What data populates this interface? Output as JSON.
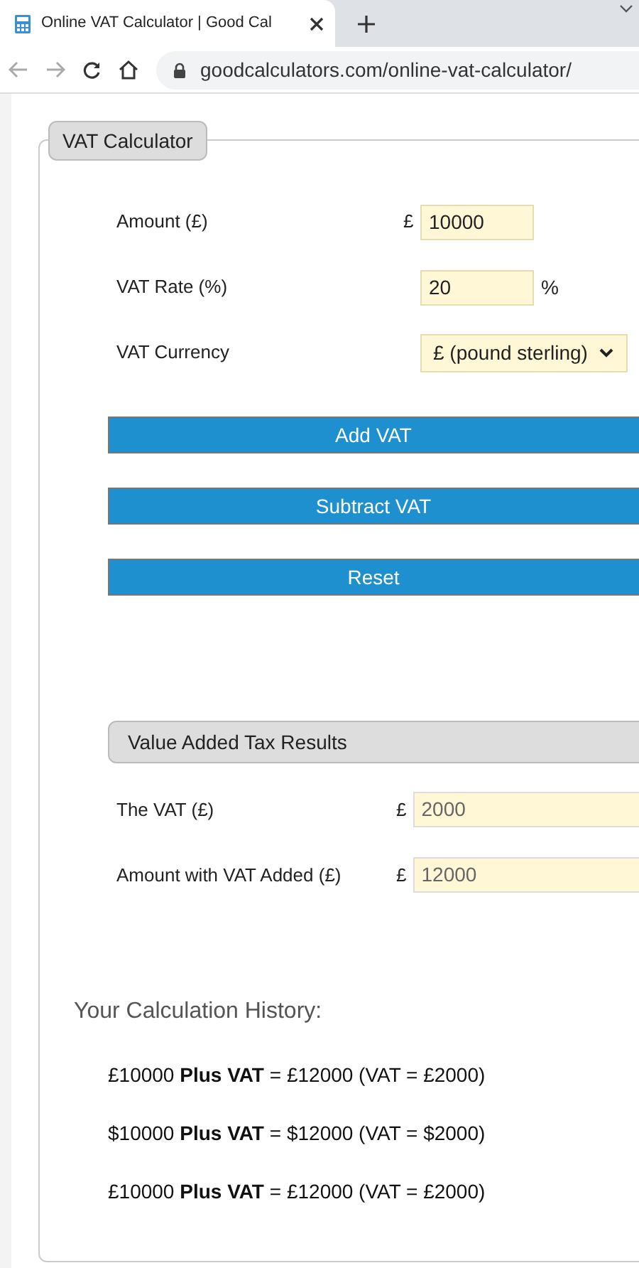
{
  "browser": {
    "tab_title": "Online VAT Calculator | Good Cal",
    "url": "goodcalculators.com/online-vat-calculator/"
  },
  "calculator": {
    "legend": "VAT Calculator",
    "fields": [
      {
        "kind": "input",
        "label": "Amount (£)",
        "prefix": "£",
        "value": "10000"
      },
      {
        "kind": "input",
        "label": "VAT Rate (%)",
        "value": "20",
        "suffix": "%"
      },
      {
        "kind": "select",
        "label": "VAT Currency",
        "value": "£ (pound sterling)"
      }
    ],
    "buttons": [
      "Add VAT",
      "Subtract VAT",
      "Reset"
    ]
  },
  "results": {
    "heading": "Value Added Tax Results",
    "fields": [
      {
        "label": "The VAT (£)",
        "prefix": "£",
        "value": "2000"
      },
      {
        "label": "Amount with VAT Added (£)",
        "prefix": "£",
        "value": "12000"
      }
    ]
  },
  "history": {
    "heading": "Your Calculation History:",
    "items": [
      "£10000 **Plus VAT** = £12000 (VAT = £2000)",
      "$10000 **Plus VAT** = $12000 (VAT = $2000)",
      "£10000 **Plus VAT** = £12000 (VAT = £2000)"
    ]
  }
}
